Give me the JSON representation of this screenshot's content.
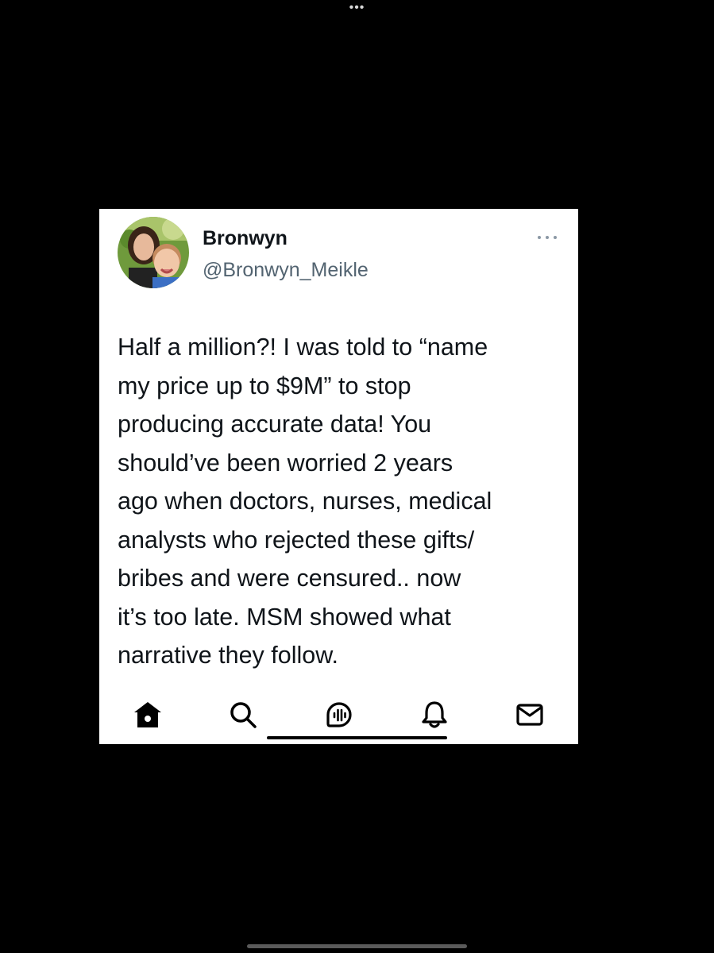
{
  "window": {
    "top_menu_glyph": "•••"
  },
  "tweet": {
    "author": {
      "display_name": "Bronwyn",
      "handle": "@Bronwyn_Meikle",
      "avatar": "profile-photo"
    },
    "more_glyph": "···",
    "text": "Half a million?! I was told to “name\nmy price up to $9M” to stop\nproducing accurate data! You\nshould’ve been worried 2 years\nago when doctors, nurses, medical\nanalysts who rejected these gifts/\nbribes and were censured.. now\nit’s too late. MSM showed what\nnarrative they follow."
  },
  "nav": {
    "items": [
      {
        "icon": "home-icon",
        "active": true
      },
      {
        "icon": "search-icon",
        "active": false
      },
      {
        "icon": "spaces-icon",
        "active": false
      },
      {
        "icon": "bell-icon",
        "active": false
      },
      {
        "icon": "mail-icon",
        "active": false
      }
    ]
  },
  "colors": {
    "background": "#000000",
    "card": "#ffffff",
    "primary_text": "#0f1419",
    "secondary_text": "#536471"
  }
}
